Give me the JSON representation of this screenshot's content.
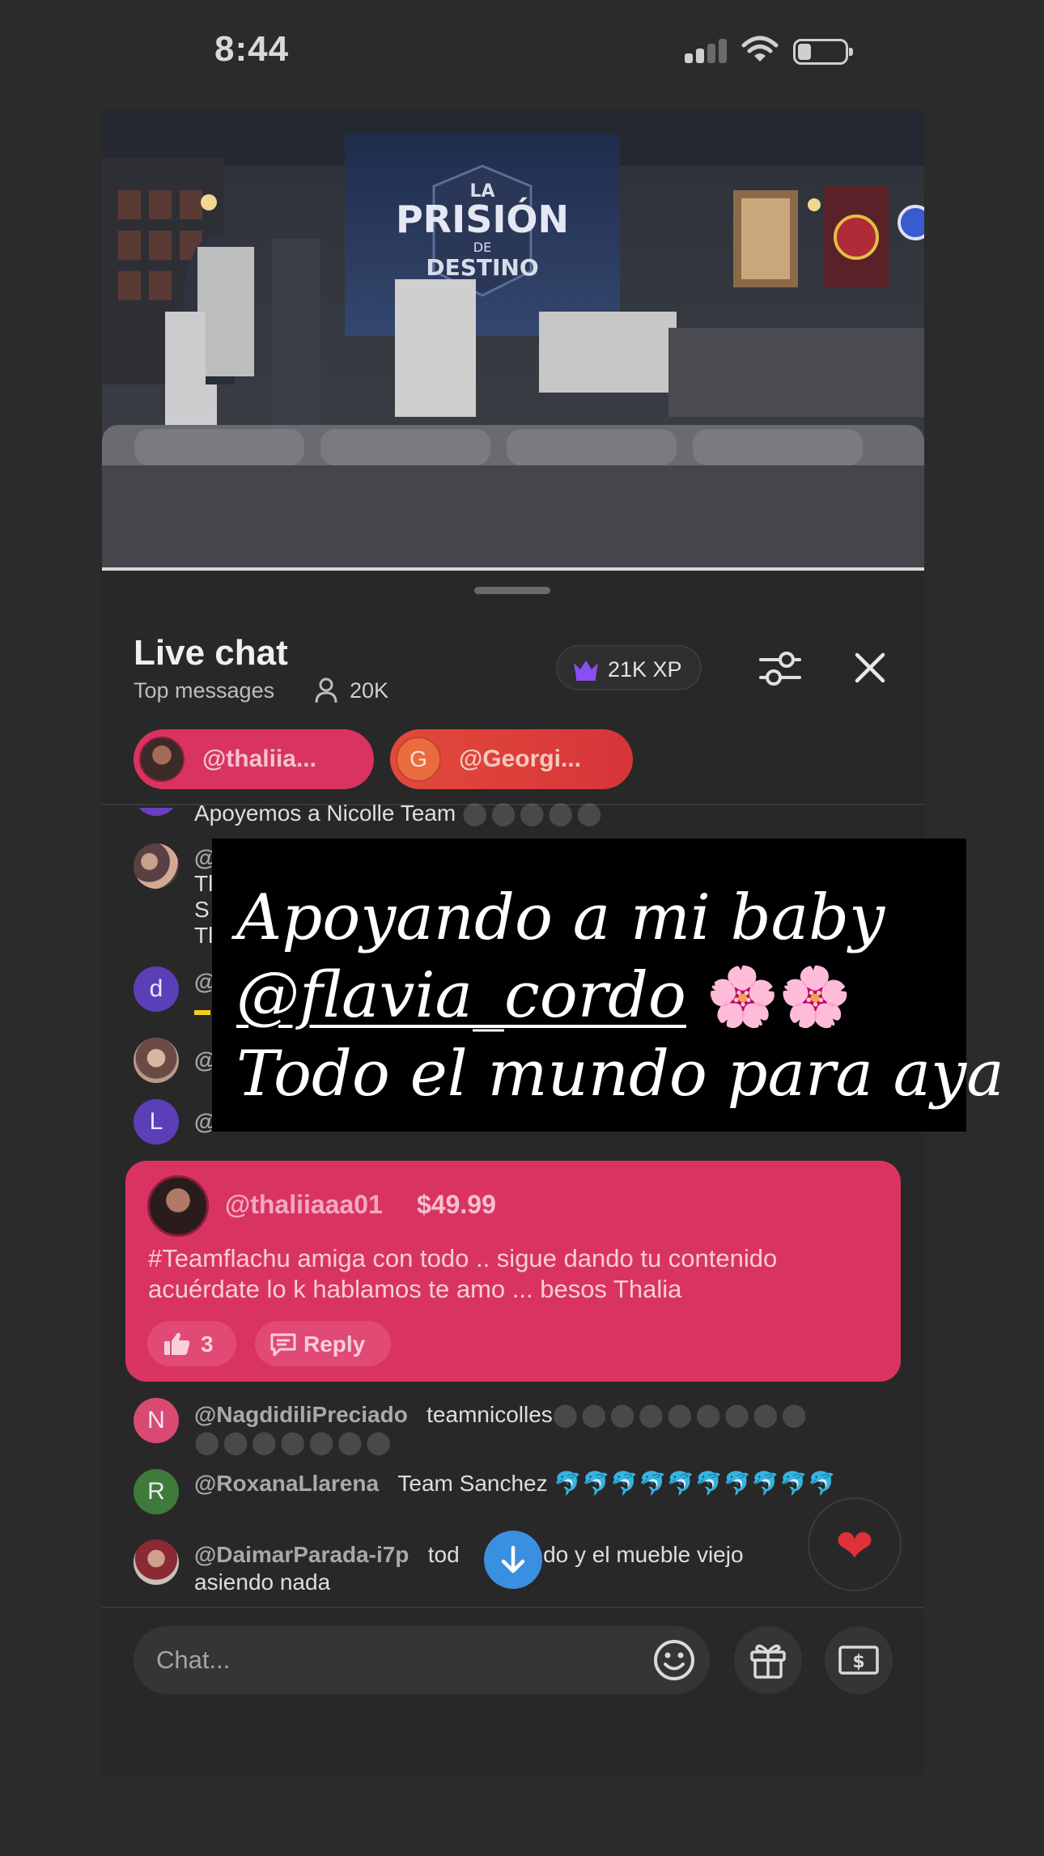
{
  "status_bar": {
    "time": "8:44"
  },
  "video": {
    "banner_line1": "LA",
    "banner_line2": "PRISIÓN",
    "banner_line3": "DE",
    "banner_line4": "DESTINO"
  },
  "chat": {
    "title": "Live chat",
    "mode": "Top messages",
    "viewers": "20K",
    "xp": "21K XP",
    "pinned": [
      {
        "name": "@thaliia..."
      },
      {
        "initial": "G",
        "name": "@Georgi..."
      }
    ],
    "partial_message": "Apoyemos a Nicolle Team",
    "partial_fragments": [
      "@",
      "Tl",
      "S",
      "Tl",
      "@",
      "@",
      "@"
    ],
    "hidden_avatars": [
      "d",
      "L"
    ],
    "messages": [
      {
        "initial": "N",
        "user": "@NagdidiliPreciado",
        "text": "teamnicolles",
        "avatar_color": "#d94a73"
      },
      {
        "initial": "R",
        "user": "@RoxanaLlarena",
        "text": "Team Sanchez 🐬🐬🐬🐬🐬🐬🐬🐬🐬🐬",
        "avatar_color": "#3e7a3a"
      },
      {
        "user": "@DaimarParada-i7p",
        "text_line1": "tod",
        "text_line1b": "siendo y el mueble viejo",
        "text_line2": "asiendo nada"
      }
    ],
    "input_placeholder": "Chat..."
  },
  "overlay": {
    "line1": "Apoyando a mi baby",
    "mention": "@flavia_cordo",
    "line2_emoji": "🌸🌸",
    "line3": "Todo el mundo para aya"
  },
  "superchat": {
    "user": "@thaliiaaa01",
    "amount": "$49.99",
    "body": "#Teamflachu amiga con todo .. sigue dando tu contenido acuérdate lo k hablamos te amo ... besos Thalia",
    "likes": "3",
    "reply_label": "Reply"
  },
  "colors": {
    "background": "#2b2b2c",
    "superchat": "#d93461",
    "chip_pink": "#d8345f",
    "chip_red": "#e14a3b",
    "scroll_button": "#3b8fe0",
    "xp_crown": "#8a4ff0"
  },
  "icons": [
    "signal-icon",
    "wifi-icon",
    "battery-icon",
    "person-icon",
    "crown-icon",
    "filter-icon",
    "close-icon",
    "thumbs-up-icon",
    "reply-icon",
    "arrow-down-icon",
    "heart-icon",
    "emoji-icon",
    "gift-icon",
    "money-icon"
  ]
}
